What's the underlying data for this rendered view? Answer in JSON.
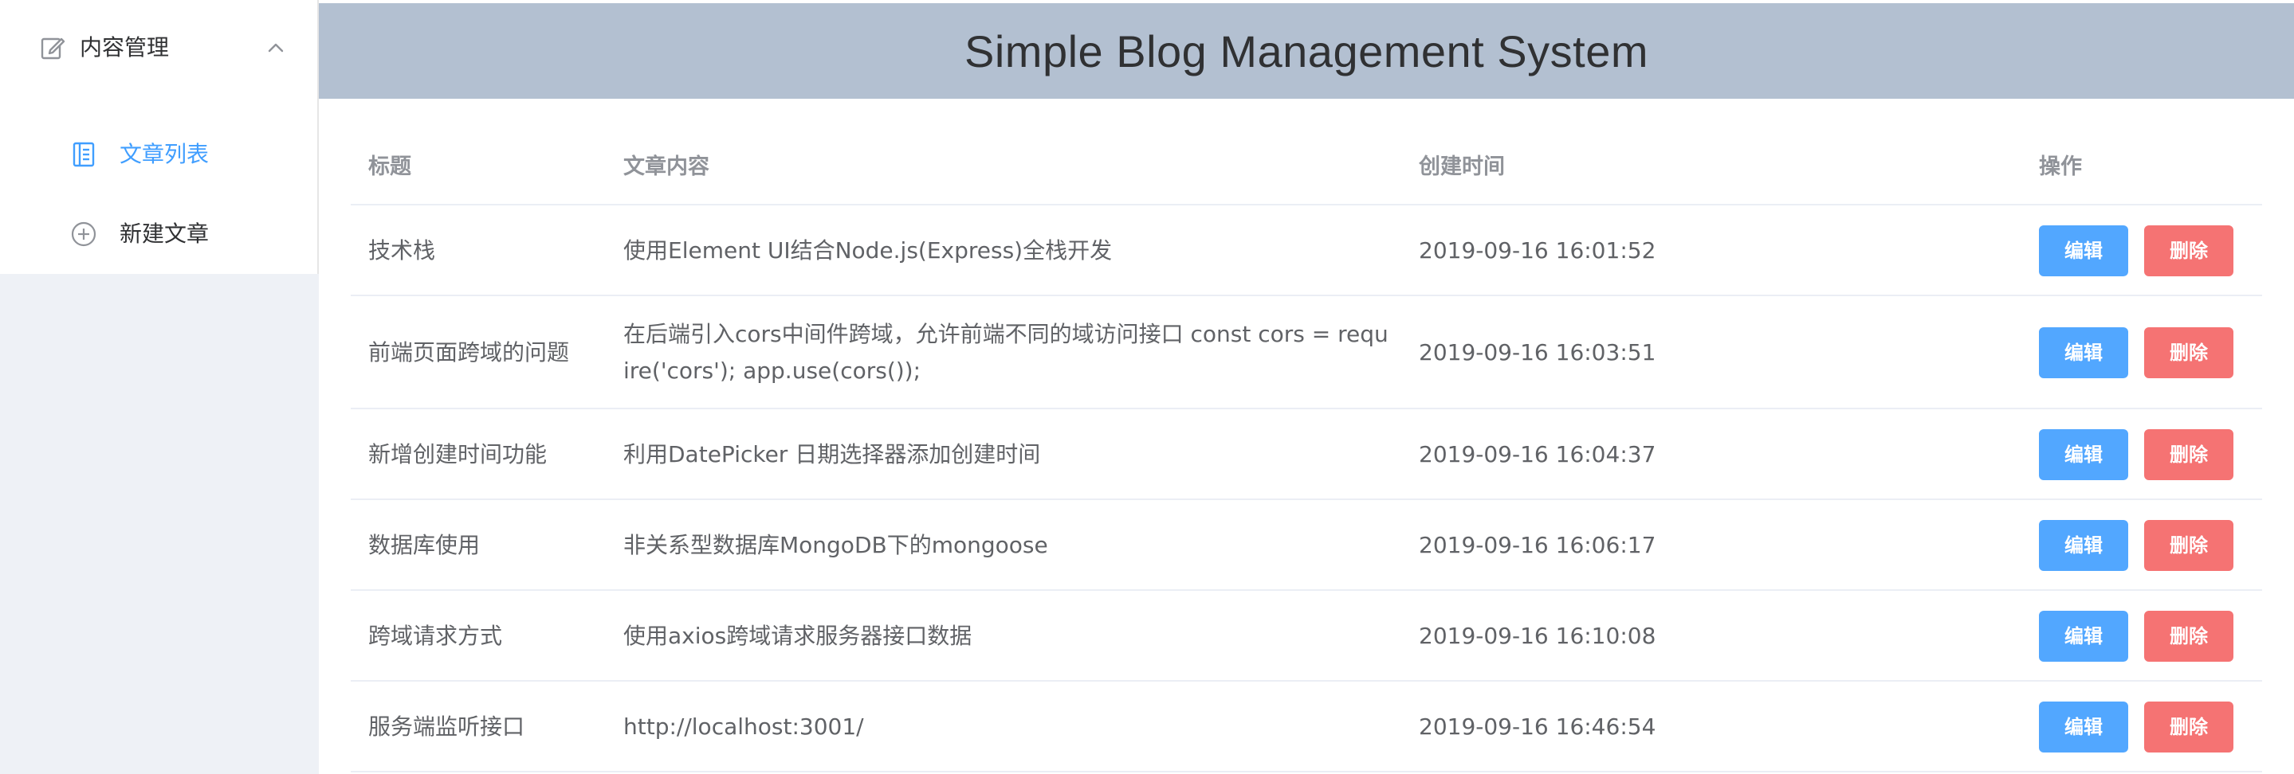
{
  "header": {
    "title": "Simple Blog Management System"
  },
  "sidebar": {
    "submenu_label": "内容管理",
    "items": [
      {
        "label": "文章列表",
        "active": true
      },
      {
        "label": "新建文章",
        "active": false
      }
    ]
  },
  "table": {
    "columns": [
      "标题",
      "文章内容",
      "创建时间",
      "操作"
    ],
    "rows": [
      {
        "title": "技术栈",
        "content": "使用Element UI结合Node.js(Express)全栈开发",
        "time": "2019-09-16 16:01:52"
      },
      {
        "title": "前端页面跨域的问题",
        "content": "在后端引入cors中间件跨域，允许前端不同的域访问接口 const cors = require('cors'); app.use(cors());",
        "time": "2019-09-16 16:03:51"
      },
      {
        "title": "新增创建时间功能",
        "content": "利用DatePicker 日期选择器添加创建时间",
        "time": "2019-09-16 16:04:37"
      },
      {
        "title": "数据库使用",
        "content": "非关系型数据库MongoDB下的mongoose",
        "time": "2019-09-16 16:06:17"
      },
      {
        "title": "跨域请求方式",
        "content": "使用axios跨域请求服务器接口数据",
        "time": "2019-09-16 16:10:08"
      },
      {
        "title": "服务端监听接口",
        "content": "http://localhost:3001/",
        "time": "2019-09-16 16:46:54"
      }
    ],
    "edit_label": "编辑",
    "delete_label": "删除"
  },
  "colors": {
    "header_bg": "#b3c0d1",
    "primary": "#409eff",
    "danger": "#f56c6c",
    "sidebar_bg": "#eef1f6"
  }
}
